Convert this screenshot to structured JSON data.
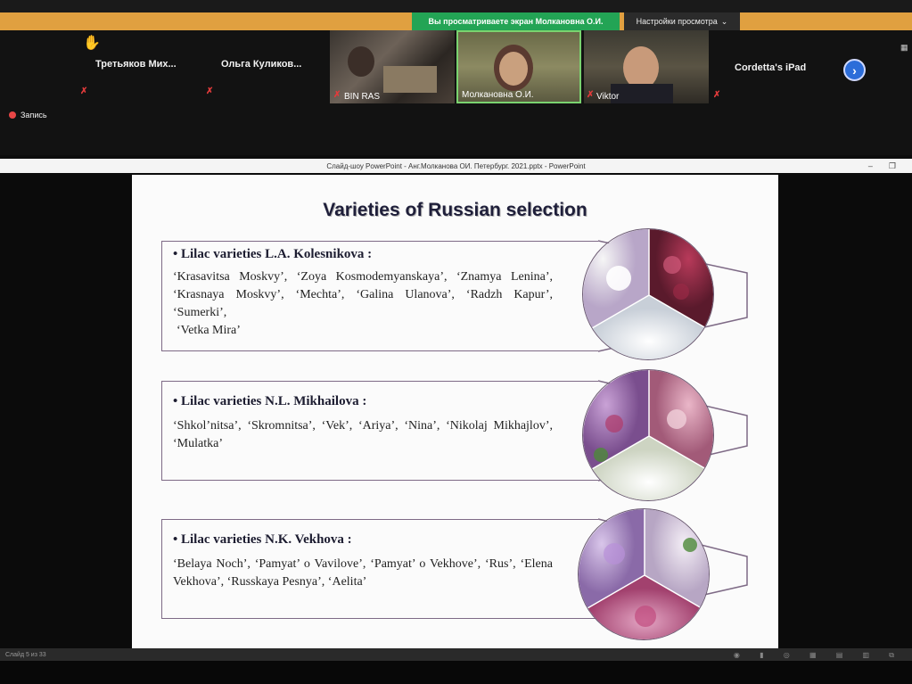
{
  "zoom": {
    "share_banner": "Вы просматриваете экран Молкановна О.И.",
    "view_settings": "Настройки просмотра",
    "participants": [
      {
        "name": "Третьяков  Мих..."
      },
      {
        "name": "Ольга  Куликов..."
      },
      {
        "name": "Cordetta's iPad"
      }
    ],
    "tiles": [
      {
        "label": "BIN RAS"
      },
      {
        "label": "Молкановна О.И."
      },
      {
        "label": "Viktor"
      }
    ],
    "recording": "Запись",
    "icons": {
      "hand": "raised-hand-icon",
      "mic": "mic-muted-icon",
      "next": "chevron-right-icon"
    }
  },
  "ppt": {
    "window_title": "Слайд-шоу PowerPoint  -  Анг.Молканова ОИ. Петербург. 2021.pptx  -  PowerPoint",
    "status": "Слайд 5 из 33"
  },
  "slide": {
    "title": "Varieties of Russian selection",
    "sections": [
      {
        "heading": "•   Lilac varieties L.A. Kolesnikova :",
        "text_main": "‘Krasavitsa Moskvy’, ‘Zoya Kosmodemyanskaya’, ‘Znamya Lenina’, ‘Krasnaya Moskvy’, ‘Mechta’, ‘Galina Ulanova’, ‘Radzh Kapur’, ‘Sumerki’,",
        "text_extra": "‘Vetka Mira’"
      },
      {
        "heading": "•   Lilac varieties N.L. Mikhailova :",
        "text_main": "‘Shkol’nitsa’, ‘Skromnitsa’, ‘Vek’, ‘Ariya’, ‘Nina’, ‘Nikolaj Mikhajlov’, ‘Mulatka’"
      },
      {
        "heading": "•   Lilac varieties N.K. Vekhova :",
        "text_main": "‘Belaya Noch’, ‘Pamyat’ o Vavilove’, ‘Pamyat’ o Vekhove’, ‘Rus’, ‘Elena Vekhova’, ‘Russkaya Pesnya’, ‘Aelita’"
      }
    ]
  }
}
